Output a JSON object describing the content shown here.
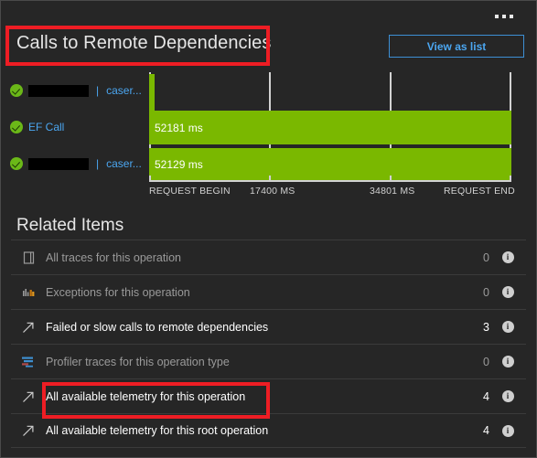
{
  "header": {
    "title": "Calls to Remote Dependencies",
    "view_as_list_label": "View as list",
    "more_icon": "ellipsis-icon"
  },
  "gantt": {
    "rows": [
      {
        "status_icon": "check-circle-icon",
        "redacted": true,
        "link_text": "caser...",
        "separator": "|",
        "bar_label": "",
        "start_pct": 0.0,
        "width_pct": 1.1
      },
      {
        "status_icon": "check-circle-icon",
        "redacted": false,
        "link_text": "EF Call",
        "separator": "",
        "bar_label": "52181 ms",
        "start_pct": 0.0,
        "width_pct": 100.0
      },
      {
        "status_icon": "check-circle-icon",
        "redacted": true,
        "link_text": "caser...",
        "separator": "|",
        "bar_label": "52129 ms",
        "start_pct": 0.0,
        "width_pct": 99.9
      }
    ],
    "axis": {
      "ticks": [
        {
          "label": "REQUEST BEGIN",
          "pct": 0
        },
        {
          "label": "17400 MS",
          "pct": 33.33
        },
        {
          "label": "34801 MS",
          "pct": 66.67
        },
        {
          "label": "REQUEST END",
          "pct": 100
        }
      ]
    },
    "bar_color": "#7ab800"
  },
  "related": {
    "heading": "Related Items",
    "rows": [
      {
        "icon": "trace-document-icon",
        "label": "All traces for this operation",
        "count": "0",
        "dim": true,
        "info_icon": "info-icon"
      },
      {
        "icon": "exceptions-bar-chart-icon",
        "label": "Exceptions for this operation",
        "count": "0",
        "dim": true,
        "info_icon": "info-icon"
      },
      {
        "icon": "arrow-up-right-icon",
        "label": "Failed or slow calls to remote dependencies",
        "count": "3",
        "dim": false,
        "info_icon": "info-icon"
      },
      {
        "icon": "profiler-traces-icon",
        "label": "Profiler traces for this operation type",
        "count": "0",
        "dim": true,
        "info_icon": "info-icon"
      },
      {
        "icon": "arrow-up-right-icon",
        "label": "All available telemetry for this operation",
        "count": "4",
        "dim": false,
        "info_icon": "info-icon"
      },
      {
        "icon": "arrow-up-right-icon",
        "label": "All available telemetry for this root operation",
        "count": "4",
        "dim": false,
        "info_icon": "info-icon"
      }
    ]
  },
  "annotations": {
    "color": "#ee1d24",
    "boxes": [
      {
        "name": "highlight-box-title"
      },
      {
        "name": "highlight-box-all-available-telemetry"
      }
    ]
  }
}
